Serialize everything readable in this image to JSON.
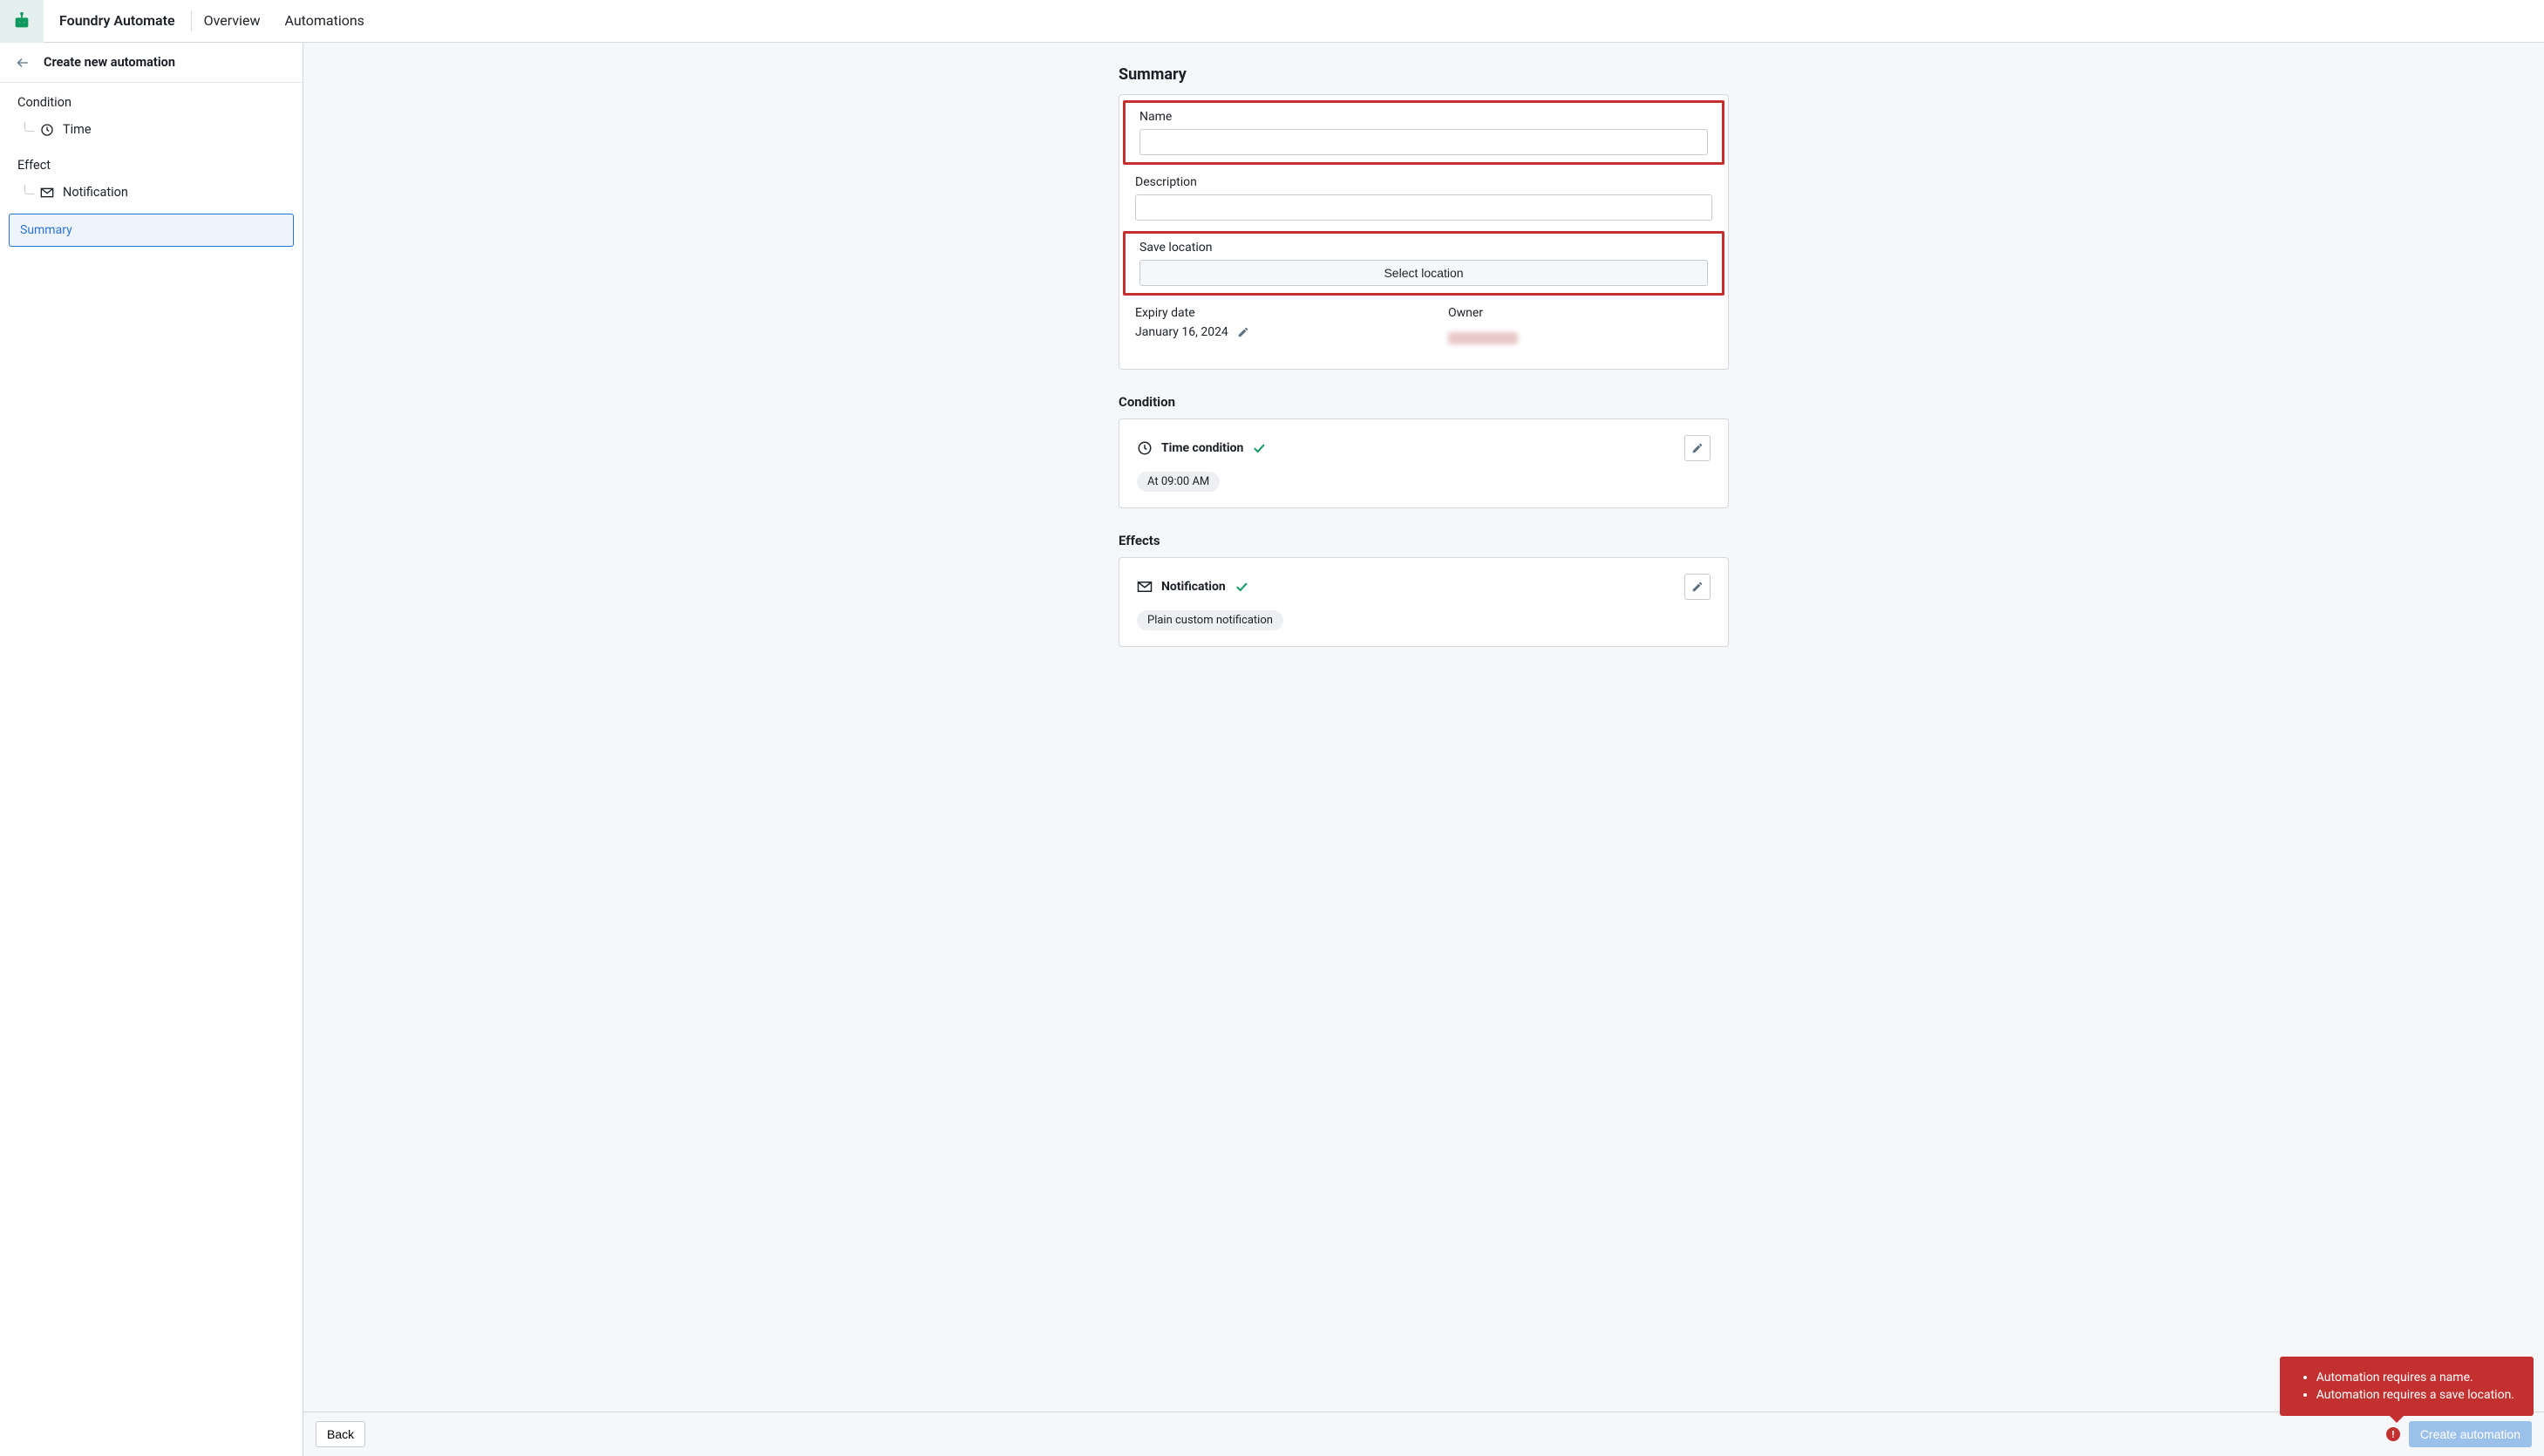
{
  "app": {
    "name": "Foundry Automate",
    "nav": {
      "overview": "Overview",
      "automations": "Automations"
    }
  },
  "sidebar": {
    "title": "Create new automation",
    "sections": {
      "condition": {
        "label": "Condition",
        "items": {
          "time": "Time"
        }
      },
      "effect": {
        "label": "Effect",
        "items": {
          "notification": "Notification"
        }
      }
    },
    "summary_item": "Summary"
  },
  "summary": {
    "title": "Summary",
    "fields": {
      "name": {
        "label": "Name",
        "value": ""
      },
      "description": {
        "label": "Description",
        "value": ""
      },
      "save_location": {
        "label": "Save location",
        "button": "Select location"
      },
      "expiry": {
        "label": "Expiry date",
        "value": "January 16, 2024"
      },
      "owner": {
        "label": "Owner"
      }
    }
  },
  "condition_section": {
    "heading": "Condition",
    "item": {
      "title": "Time condition",
      "chip": "At 09:00 AM"
    }
  },
  "effects_section": {
    "heading": "Effects",
    "item": {
      "title": "Notification",
      "chip": "Plain custom notification"
    }
  },
  "footer": {
    "back": "Back",
    "create": "Create automation"
  },
  "errors": {
    "items": [
      "Automation requires a name.",
      "Automation requires a save location."
    ]
  }
}
